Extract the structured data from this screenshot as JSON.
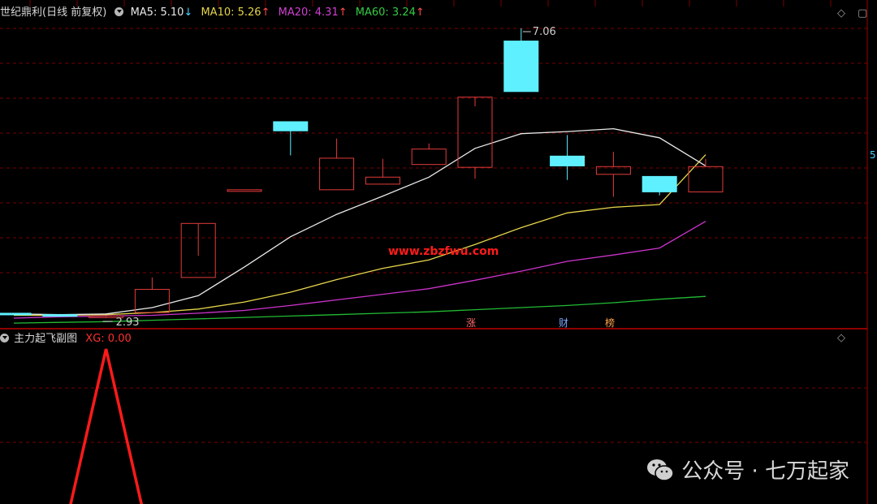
{
  "header": {
    "stock_title": "世纪鼎利(日线 前复权)",
    "ma5": "MA5: 5.10",
    "ma5_arrow": "↓",
    "ma10": "MA10: 5.26",
    "ma10_arrow": "↑",
    "ma20": "MA20: 4.31",
    "ma20_arrow": "↑",
    "ma60": "MA60: 3.24",
    "ma60_arrow": "↑"
  },
  "colors": {
    "up_red": "#e33b3b",
    "down_cyan": "#5ff0ff",
    "ma5": "#e8e8e8",
    "ma10": "#e6d54a",
    "ma20": "#cc33cc",
    "ma60": "#22bb33",
    "grid": "#7a0000",
    "xg_line": "#ff1a1a"
  },
  "price_annotations": {
    "high_label": "7.06",
    "low_label": "2.93",
    "right_edge_label": "5"
  },
  "event_tags": [
    {
      "text": "涨",
      "color": "#ff6a6a"
    },
    {
      "text": "财",
      "color": "#7aa8ff"
    },
    {
      "text": "榜",
      "color": "#ffa24a"
    }
  ],
  "watermark": "www.zbzfwu.com",
  "sub_panel": {
    "title": "主力起飞副图",
    "xg_label": "XG: 0.00"
  },
  "wechat_caption": "公众号 · 七万起家",
  "chart_data": {
    "type": "candlestick",
    "candles": [
      {
        "o": 3.0,
        "h": 3.0,
        "l": 2.99,
        "c": 2.99
      },
      {
        "o": 2.98,
        "h": 2.99,
        "l": 2.97,
        "c": 2.97
      },
      {
        "o": 2.95,
        "h": 2.97,
        "l": 2.93,
        "c": 2.96
      },
      {
        "o": 3.01,
        "h": 3.51,
        "l": 3.01,
        "c": 3.34
      },
      {
        "o": 3.51,
        "h": 3.82,
        "l": 3.51,
        "c": 4.28
      },
      {
        "o": 4.76,
        "h": 4.76,
        "l": 4.76,
        "c": 4.76
      },
      {
        "o": 5.73,
        "h": 5.73,
        "l": 5.25,
        "c": 5.6
      },
      {
        "o": 4.76,
        "h": 5.49,
        "l": 4.76,
        "c": 5.21
      },
      {
        "o": 4.84,
        "h": 5.2,
        "l": 4.84,
        "c": 4.94
      },
      {
        "o": 5.12,
        "h": 5.42,
        "l": 5.12,
        "c": 5.34
      },
      {
        "o": 5.08,
        "h": 5.95,
        "l": 4.92,
        "c": 6.08
      },
      {
        "o": 6.88,
        "h": 7.06,
        "l": 6.16,
        "c": 6.16
      },
      {
        "o": 5.24,
        "h": 5.54,
        "l": 4.9,
        "c": 5.1
      },
      {
        "o": 4.98,
        "h": 5.3,
        "l": 4.66,
        "c": 5.09
      },
      {
        "o": 4.95,
        "h": 4.95,
        "l": 4.68,
        "c": 4.73
      },
      {
        "o": 4.73,
        "h": 5.2,
        "l": 4.73,
        "c": 5.09
      }
    ],
    "ma5": [
      2.99,
      2.98,
      2.99,
      3.08,
      3.25,
      3.66,
      4.09,
      4.41,
      4.67,
      4.94,
      5.35,
      5.56,
      5.59,
      5.63,
      5.5,
      5.1
    ],
    "ma10": [
      2.97,
      2.97,
      2.98,
      3.01,
      3.06,
      3.16,
      3.3,
      3.48,
      3.64,
      3.76,
      3.98,
      4.22,
      4.43,
      4.51,
      4.55,
      5.26
    ],
    "ma20": [
      2.93,
      2.95,
      2.96,
      2.97,
      3.0,
      3.04,
      3.11,
      3.19,
      3.27,
      3.35,
      3.47,
      3.6,
      3.74,
      3.83,
      3.93,
      4.31
    ],
    "ma60": [
      2.86,
      2.87,
      2.88,
      2.9,
      2.92,
      2.94,
      2.96,
      2.98,
      3.0,
      3.02,
      3.05,
      3.08,
      3.11,
      3.15,
      3.2,
      3.24
    ],
    "xg": [
      0,
      0,
      1,
      0,
      0,
      0,
      0,
      0,
      0,
      0,
      0,
      0,
      0,
      0,
      0,
      0
    ]
  }
}
